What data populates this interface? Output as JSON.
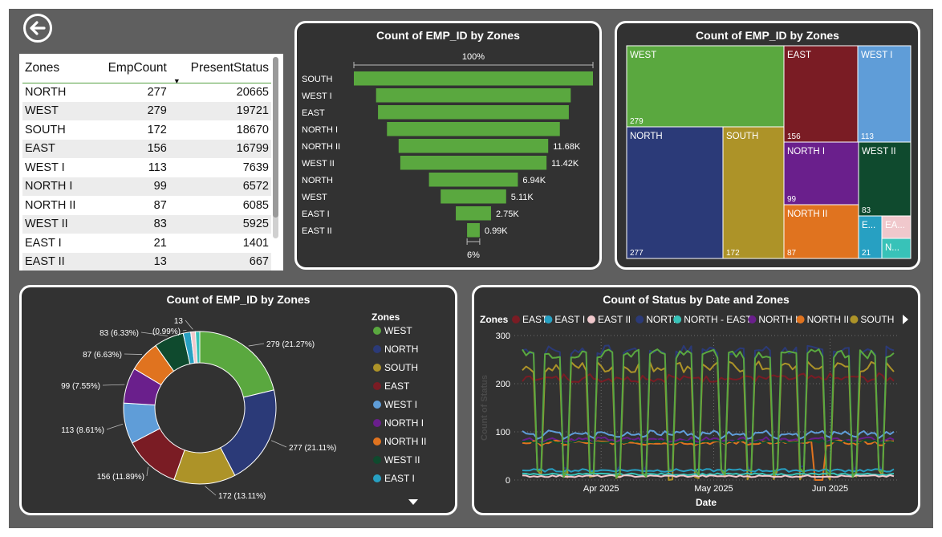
{
  "colors": {
    "WEST": "#5aa83f",
    "NORTH": "#2b3a78",
    "SOUTH": "#ad9328",
    "EAST": "#7a1c24",
    "WEST I": "#5f9dd8",
    "NORTH I": "#6a1f8c",
    "NORTH II": "#e0731f",
    "WEST II": "#0f4a2e",
    "EAST I": "#27a0c2",
    "EAST II": "#f0c8cc",
    "NORTH - EAST": "#38c2b8"
  },
  "icons": {
    "back": "back-arrow-circle-icon",
    "legend_scroll": "triangle-down-icon",
    "legend_next": "triangle-right-icon"
  },
  "table": {
    "headers": [
      "Zones",
      "EmpCount",
      "PresentStatus"
    ],
    "rows": [
      [
        "NORTH",
        "277",
        "20665"
      ],
      [
        "WEST",
        "279",
        "19721"
      ],
      [
        "SOUTH",
        "172",
        "18670"
      ],
      [
        "EAST",
        "156",
        "16799"
      ],
      [
        "WEST I",
        "113",
        "7639"
      ],
      [
        "NORTH I",
        "99",
        "6572"
      ],
      [
        "NORTH II",
        "87",
        "6085"
      ],
      [
        "WEST II",
        "83",
        "5925"
      ],
      [
        "EAST I",
        "21",
        "1401"
      ],
      [
        "EAST II",
        "13",
        "667"
      ]
    ]
  },
  "funnel": {
    "title": "Count of EMP_ID by Zones",
    "top_pct": "100%",
    "bottom_pct": "6%",
    "categories": [
      "SOUTH",
      "WEST I",
      "EAST",
      "NORTH I",
      "NORTH II",
      "WEST II",
      "NORTH",
      "WEST",
      "EAST I",
      "EAST II"
    ],
    "values": [
      18.67,
      15.2,
      14.9,
      13.5,
      11.68,
      11.42,
      6.94,
      5.11,
      2.75,
      0.99
    ],
    "labels": [
      "",
      "",
      "",
      "",
      "11.68K",
      "11.42K",
      "6.94K",
      "5.11K",
      "2.75K",
      "0.99K"
    ]
  },
  "treemap": {
    "title": "Count of EMP_ID by Zones",
    "items": [
      {
        "name": "WEST",
        "value": "279"
      },
      {
        "name": "EAST",
        "value": "156"
      },
      {
        "name": "WEST I",
        "value": "113"
      },
      {
        "name": "NORTH",
        "value": "277"
      },
      {
        "name": "SOUTH",
        "value": "172"
      },
      {
        "name": "NORTH I",
        "value": "99"
      },
      {
        "name": "WEST II",
        "value": "83"
      },
      {
        "name": "NORTH II",
        "value": "87"
      },
      {
        "name": "E...",
        "value": "21"
      },
      {
        "name": "EA...",
        "value": ""
      },
      {
        "name": "N...",
        "value": ""
      }
    ]
  },
  "donut": {
    "title": "Count of EMP_ID by Zones",
    "legend_title": "Zones",
    "legend": [
      "WEST",
      "NORTH",
      "SOUTH",
      "EAST",
      "WEST I",
      "NORTH I",
      "NORTH II",
      "WEST II",
      "EAST I"
    ],
    "slices": [
      {
        "name": "WEST",
        "value": 279,
        "label": "279 (21.27%)"
      },
      {
        "name": "NORTH",
        "value": 277,
        "label": "277 (21.11%)"
      },
      {
        "name": "SOUTH",
        "value": 172,
        "label": "172 (13.11%)"
      },
      {
        "name": "EAST",
        "value": 156,
        "label": "156 (11.89%)"
      },
      {
        "name": "WEST I",
        "value": 113,
        "label": "113 (8.61%)"
      },
      {
        "name": "NORTH I",
        "value": 99,
        "label": "99 (7.55%)"
      },
      {
        "name": "NORTH II",
        "value": 87,
        "label": "87 (6.63%)"
      },
      {
        "name": "WEST II",
        "value": 83,
        "label": "83 (6.33%)"
      },
      {
        "name": "EAST I",
        "value": 21,
        "label": "(0.99%)"
      },
      {
        "name": "EAST II",
        "value": 13,
        "label": "13"
      },
      {
        "name": "NORTH - EAST",
        "value": 12,
        "label": ""
      }
    ]
  },
  "chart_data": {
    "type": "line",
    "title": "Count of Status by Date and Zones",
    "legend_title": "Zones",
    "legend": [
      "EAST",
      "EAST I",
      "EAST II",
      "NORTH",
      "NORTH - EAST",
      "NORTH I",
      "NORTH II",
      "SOUTH"
    ],
    "xlabel": "Date",
    "ylabel": "Count of Status",
    "x_ticks": [
      "Apr 2025",
      "May 2025",
      "Jun 2025"
    ],
    "y_ticks": [
      "0",
      "100",
      "200",
      "300"
    ],
    "ylim": [
      0,
      300
    ],
    "series": [
      {
        "name": "NORTH",
        "pattern": "weekly",
        "base": 270,
        "weekend": 20,
        "jitter": 10
      },
      {
        "name": "EAST",
        "pattern": "weekly",
        "base": 210,
        "weekend": 215,
        "jitter": 7
      },
      {
        "name": "SOUTH",
        "pattern": "weekly",
        "base": 235,
        "weekend": 10,
        "jitter": 12
      },
      {
        "name": "WEST I",
        "pattern": "weekly",
        "base": 98,
        "weekend": 90,
        "jitter": 5
      },
      {
        "name": "NORTH I",
        "pattern": "weekly",
        "base": 85,
        "weekend": 80,
        "jitter": 4
      },
      {
        "name": "NORTH II",
        "pattern": "weekly",
        "base": 78,
        "weekend": 75,
        "jitter": 4
      },
      {
        "name": "WEST II",
        "pattern": "weekly",
        "base": 80,
        "weekend": 78,
        "jitter": 3
      },
      {
        "name": "EAST I",
        "pattern": "weekly",
        "base": 20,
        "weekend": 20,
        "jitter": 3
      },
      {
        "name": "NORTH - EAST",
        "pattern": "weekly",
        "base": 12,
        "weekend": 12,
        "jitter": 2
      },
      {
        "name": "EAST II",
        "pattern": "weekly",
        "base": 8,
        "weekend": 8,
        "jitter": 2
      },
      {
        "name": "WEST",
        "pattern": "weekly",
        "base": 262,
        "weekend": 15,
        "jitter": 10
      }
    ]
  }
}
